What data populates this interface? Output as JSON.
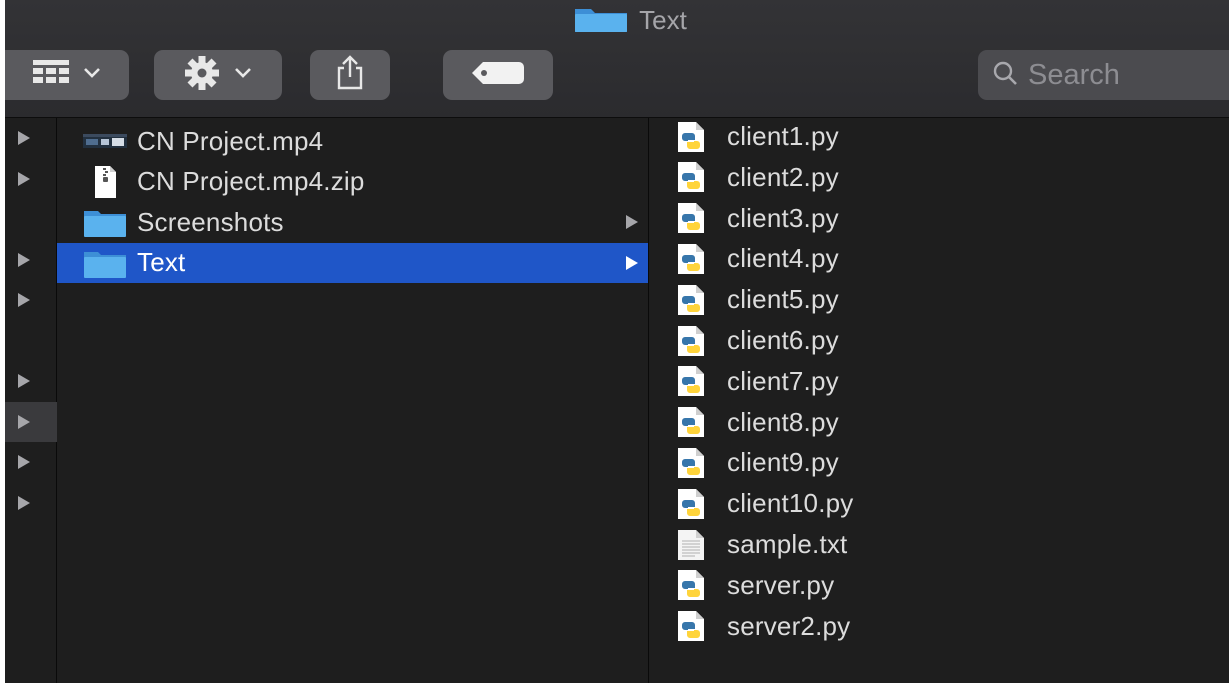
{
  "window": {
    "title": "Text"
  },
  "toolbar": {
    "view_button_icon": "grid-view-icon",
    "action_button_icon": "gear-icon",
    "share_button_icon": "share-icon",
    "tag_button_icon": "tag-icon",
    "search_placeholder": "Search"
  },
  "sidebar_column": {
    "rows": [
      {
        "has_arrow": true
      },
      {
        "has_arrow": true
      },
      {
        "has_arrow": false
      },
      {
        "has_arrow": true
      },
      {
        "has_arrow": true
      },
      {
        "has_arrow": false
      },
      {
        "has_arrow": true
      },
      {
        "has_arrow": true,
        "selected": true
      },
      {
        "has_arrow": true
      },
      {
        "has_arrow": true
      }
    ]
  },
  "parent_column": {
    "items": [
      {
        "name": "CN Project.mp4",
        "icon": "video-thumbnail-icon",
        "has_children": false,
        "selected": false
      },
      {
        "name": "CN Project.mp4.zip",
        "icon": "zip-file-icon",
        "has_children": false,
        "selected": false
      },
      {
        "name": "Screenshots",
        "icon": "folder-icon",
        "has_children": true,
        "selected": false
      },
      {
        "name": "Text",
        "icon": "folder-icon",
        "has_children": true,
        "selected": true
      }
    ]
  },
  "content_column": {
    "items": [
      {
        "name": "client1.py",
        "icon": "python-file-icon"
      },
      {
        "name": "client2.py",
        "icon": "python-file-icon"
      },
      {
        "name": "client3.py",
        "icon": "python-file-icon"
      },
      {
        "name": "client4.py",
        "icon": "python-file-icon"
      },
      {
        "name": "client5.py",
        "icon": "python-file-icon"
      },
      {
        "name": "client6.py",
        "icon": "python-file-icon"
      },
      {
        "name": "client7.py",
        "icon": "python-file-icon"
      },
      {
        "name": "client8.py",
        "icon": "python-file-icon"
      },
      {
        "name": "client9.py",
        "icon": "python-file-icon"
      },
      {
        "name": "client10.py",
        "icon": "python-file-icon"
      },
      {
        "name": "sample.txt",
        "icon": "text-file-icon"
      },
      {
        "name": "server.py",
        "icon": "python-file-icon"
      },
      {
        "name": "server2.py",
        "icon": "python-file-icon"
      }
    ]
  },
  "colors": {
    "window_bg": "#1e1e1e",
    "toolbar_button": "#5a5a5e",
    "selection": "#1f56c8",
    "folder_blue": "#4aa3e6",
    "text": "#dcdcdc"
  }
}
